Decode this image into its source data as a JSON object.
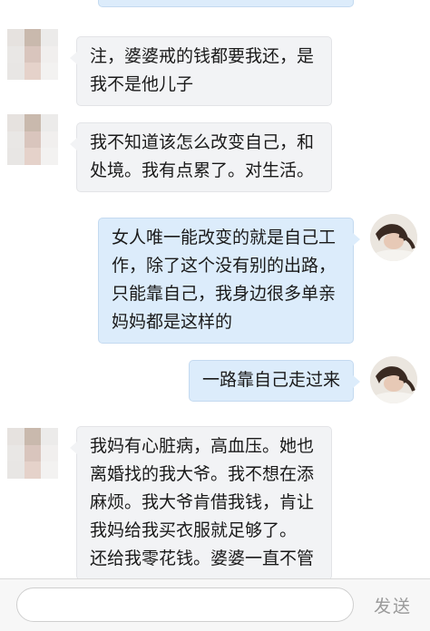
{
  "messages": [
    {
      "side": "in",
      "text": "注，婆婆戒的钱都要我还，是\n我不是他儿子"
    },
    {
      "side": "in",
      "text": "我不知道该怎么改变自己，和\n处境。我有点累了。对生活。"
    },
    {
      "side": "out",
      "text": "女人唯一能改变的就是自己工\n作，除了这个没有别的出路，\n只能靠自己，我身边很多单亲\n妈妈都是这样的"
    },
    {
      "side": "out",
      "text": "一路靠自己走过来"
    },
    {
      "side": "in",
      "text": "我妈有心脏病，高血压。她也\n离婚找的我大爷。我不想在添\n麻烦。我大爷肯借我钱，肯让\n我妈给我买衣服就足够了。\n还给我零花钱。婆婆一直不管"
    }
  ],
  "input": {
    "value": "",
    "placeholder": ""
  },
  "send_label": "发送",
  "colors": {
    "incoming_bubble": "#f2f3f5",
    "outgoing_bubble": "#dcecfb",
    "send_text": "#9a9a9a"
  },
  "avatar_mosaic": [
    "#e6e2df",
    "#c9b9ad",
    "#ecebea",
    "#e9e7e5",
    "#d9c5bd",
    "#f1efee",
    "#e8e6e4",
    "#e5d2ca",
    "#f3f2f1"
  ]
}
